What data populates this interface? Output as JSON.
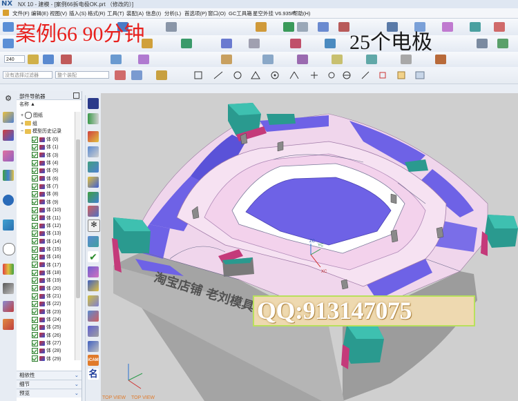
{
  "window": {
    "logo": "NX",
    "title": "NX 10 - 建模 - [案例66拆电极OK.prt （修改的）]"
  },
  "menubar": {
    "items": [
      "文件(F)",
      "编辑(E)",
      "视图(V)",
      "插入(S)",
      "格式(R)",
      "工具(T)",
      "装配(A)",
      "信息(I)",
      "分析(L)",
      "首选项(P)",
      "窗口(O)",
      "GC工具箱",
      "星空外挂 V6.935F",
      "帮助(H)"
    ]
  },
  "overlay": {
    "case_title": "案例66   90分钟",
    "electrode_count": "25个电极"
  },
  "selection_bar": {
    "layer_value": "240",
    "filter_placeholder": "没有选择过滤器",
    "assembly_placeholder": "整个装配"
  },
  "part_navigator": {
    "title": "部件导航器",
    "column_header": "名称",
    "nodes": {
      "drawing": "图纸",
      "group": "组",
      "history": "模型历史记录"
    },
    "bodies": [
      "体 (0)",
      "体 (1)",
      "体 (3)",
      "体 (4)",
      "体 (5)",
      "体 (6)",
      "体 (7)",
      "体 (8)",
      "体 (9)",
      "体 (10)",
      "体 (11)",
      "体 (12)",
      "体 (13)",
      "体 (14)",
      "体 (15)",
      "体 (16)",
      "体 (17)",
      "体 (18)",
      "体 (19)",
      "体 (20)",
      "体 (21)",
      "体 (22)",
      "体 (23)",
      "体 (24)",
      "体 (25)",
      "体 (26)",
      "体 (27)",
      "体 (28)",
      "体 (29)"
    ],
    "panels": [
      "相依性",
      "细节",
      "预览"
    ]
  },
  "viewport": {
    "engraving": "淘宝店铺 老刘模具工作室",
    "qq": "QQ:913147075",
    "axis_labels": {
      "zc": "ZC",
      "yc": "YC",
      "xc": "XC"
    },
    "view_labels": [
      "TOP VIEW",
      "TOP VIEW"
    ]
  },
  "vertical_toolbar": {
    "icam_label": "iCAM",
    "name_glyph": "名"
  },
  "colors": {
    "mold_pink": "#f3d7ee",
    "mold_purple": "#6e62e6",
    "mold_teal": "#2a9a8f",
    "mold_magenta": "#c43a7a",
    "mold_side_gray": "#a8a8a8",
    "viewport_bg": "#cfcfcf",
    "overlay_red": "#e8211e",
    "qq_bg": "#eed9b0",
    "qq_border": "#b8e05c"
  }
}
